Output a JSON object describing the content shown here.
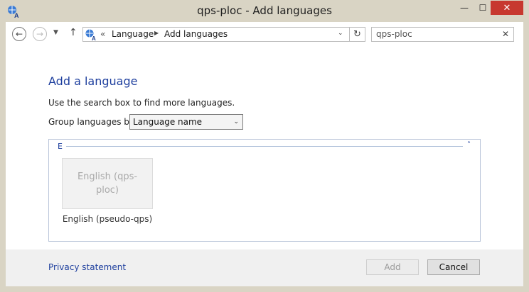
{
  "window": {
    "title": "qps-ploc - Add languages",
    "minimize_glyph": "—",
    "maximize_glyph": "☐",
    "close_glyph": "✕",
    "app_icon": "language-globe-icon"
  },
  "navbar": {
    "back_glyph": "←",
    "forward_glyph": "→",
    "recent_glyph": "▼",
    "up_glyph": "↑",
    "address_chevron": "«",
    "breadcrumbs": [
      "Language",
      "Add languages"
    ],
    "crumb_separator": "▶",
    "address_dropdown_glyph": "⌄",
    "refresh_glyph": "↻",
    "search_value": "qps-ploc",
    "search_clear_glyph": "✕"
  },
  "main": {
    "heading": "Add a language",
    "hint": "Use the search box to find more languages.",
    "group_label": "Group languages by:",
    "group_select_value": "Language name",
    "group_select_arrow": "⌄",
    "groups": [
      {
        "letter": "E",
        "collapse_glyph": "˄",
        "items": [
          {
            "tile_text": "English (qps-ploc)",
            "caption": "English (pseudo-qps)"
          }
        ]
      }
    ]
  },
  "footer": {
    "privacy_link": "Privacy statement",
    "add_button": "Add",
    "cancel_button": "Cancel"
  },
  "colors": {
    "accent": "#1e3f9e",
    "frame": "#d9d4c4",
    "close_button": "#c7382f"
  }
}
